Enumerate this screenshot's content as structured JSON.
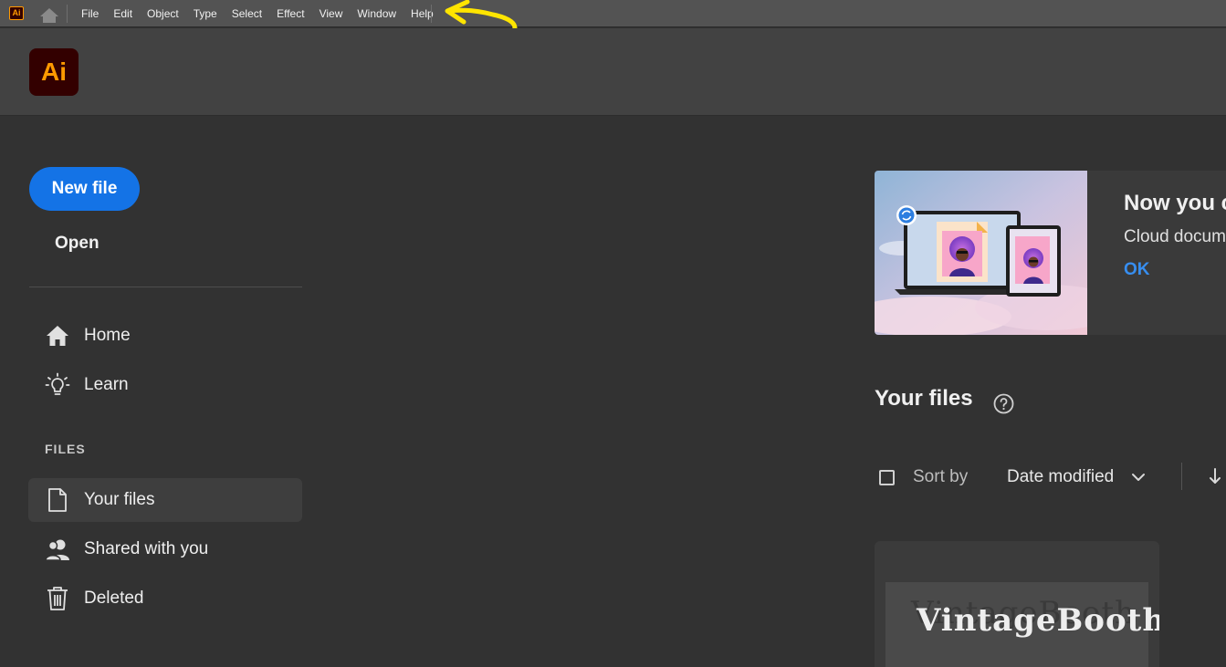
{
  "menubar": {
    "app_badge": "Ai",
    "items": [
      "File",
      "Edit",
      "Object",
      "Type",
      "Select",
      "Effect",
      "View",
      "Window",
      "Help"
    ]
  },
  "header": {
    "logo_text": "Ai"
  },
  "sidebar": {
    "new_file": "New file",
    "open": "Open",
    "nav": [
      {
        "label": "Home",
        "icon": "home-icon"
      },
      {
        "label": "Learn",
        "icon": "lightbulb-icon"
      }
    ],
    "files_heading": "FILES",
    "files_nav": [
      {
        "label": "Your files",
        "icon": "file-icon",
        "active": true
      },
      {
        "label": "Shared with you",
        "icon": "people-icon"
      },
      {
        "label": "Deleted",
        "icon": "trash-icon"
      }
    ]
  },
  "banner": {
    "title": "Now you c",
    "text": "Cloud docum",
    "ok": "OK"
  },
  "files": {
    "title": "Your files",
    "sort_by": "Sort by",
    "sort_value": "Date modified",
    "card_thumb_text": "VintageBooth"
  },
  "colors": {
    "accent": "#1473e6",
    "link": "#378ef0",
    "annotation": "#ffe500",
    "ai_orange": "#ff9a00",
    "ai_dark": "#330000"
  }
}
